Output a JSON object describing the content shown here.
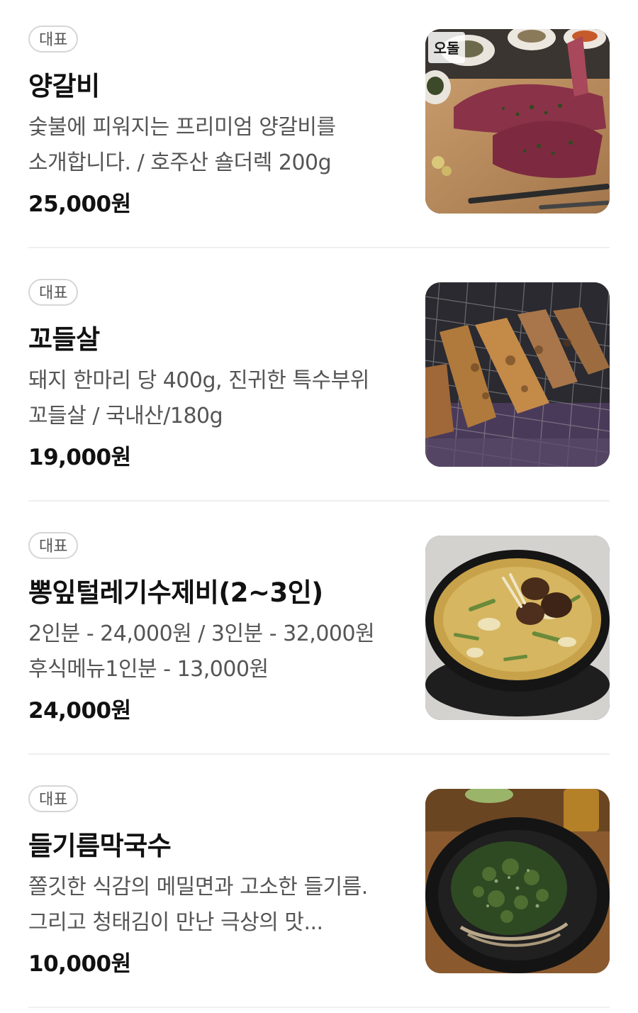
{
  "menu": {
    "items": [
      {
        "badge": "대표",
        "name": "양갈비",
        "description": "숯불에 피워지는 프리미엄 양갈비를 소개합니다. / 호주산 숄더렉 200g",
        "price": "25,000원",
        "image_logo_text": "오돌"
      },
      {
        "badge": "대표",
        "name": "꼬들살",
        "description": "돼지 한마리 당 400g, 진귀한 특수부위 꼬들살 / 국내산/180g",
        "price": "19,000원"
      },
      {
        "badge": "대표",
        "name": "뽕잎털레기수제비(2~3인)",
        "description": "2인분 - 24,000원 / 3인분 - 32,000원 후식메뉴1인분 - 13,000원",
        "price": "24,000원"
      },
      {
        "badge": "대표",
        "name": "들기름막국수",
        "description": "쫄깃한 식감의 메밀면과 고소한 들기름. 그리고 청태김이 만난 극상의 맛...",
        "price": "10,000원"
      }
    ]
  }
}
